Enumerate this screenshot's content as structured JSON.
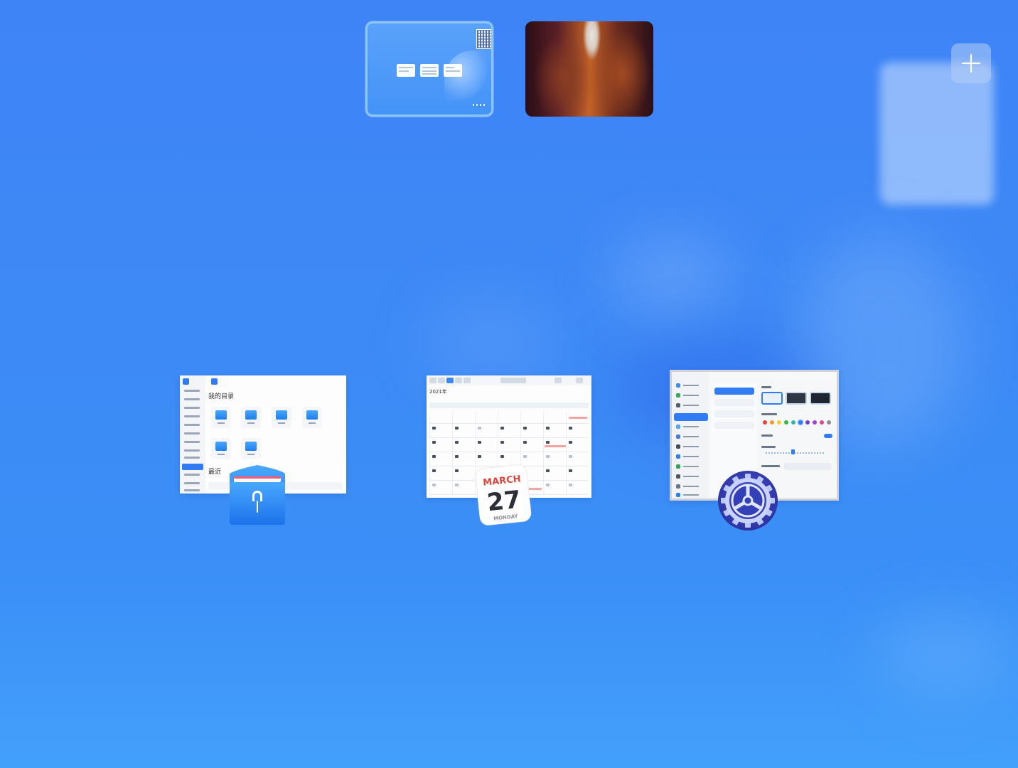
{
  "workspaces": [
    {
      "name": "workspace-1",
      "active": true
    },
    {
      "name": "workspace-2",
      "active": false
    }
  ],
  "add_workspace_button": {
    "icon": "plus-icon"
  },
  "windows": [
    {
      "app": "file-manager",
      "icon": "file-manager-icon",
      "heading": "我的目录",
      "subheading": "最近"
    },
    {
      "app": "calendar",
      "icon": "calendar-icon",
      "year_label": "2021年",
      "icon_month": "MARCH",
      "icon_day": "27",
      "icon_weekday": "MONDAY"
    },
    {
      "app": "control-center",
      "icon": "settings-gear-icon"
    }
  ],
  "colors": {
    "background": "#3d8af6",
    "accent": "#2f7cf5",
    "active_workspace_border": "#8cc6ff",
    "calendar_month": "#e0453f"
  }
}
